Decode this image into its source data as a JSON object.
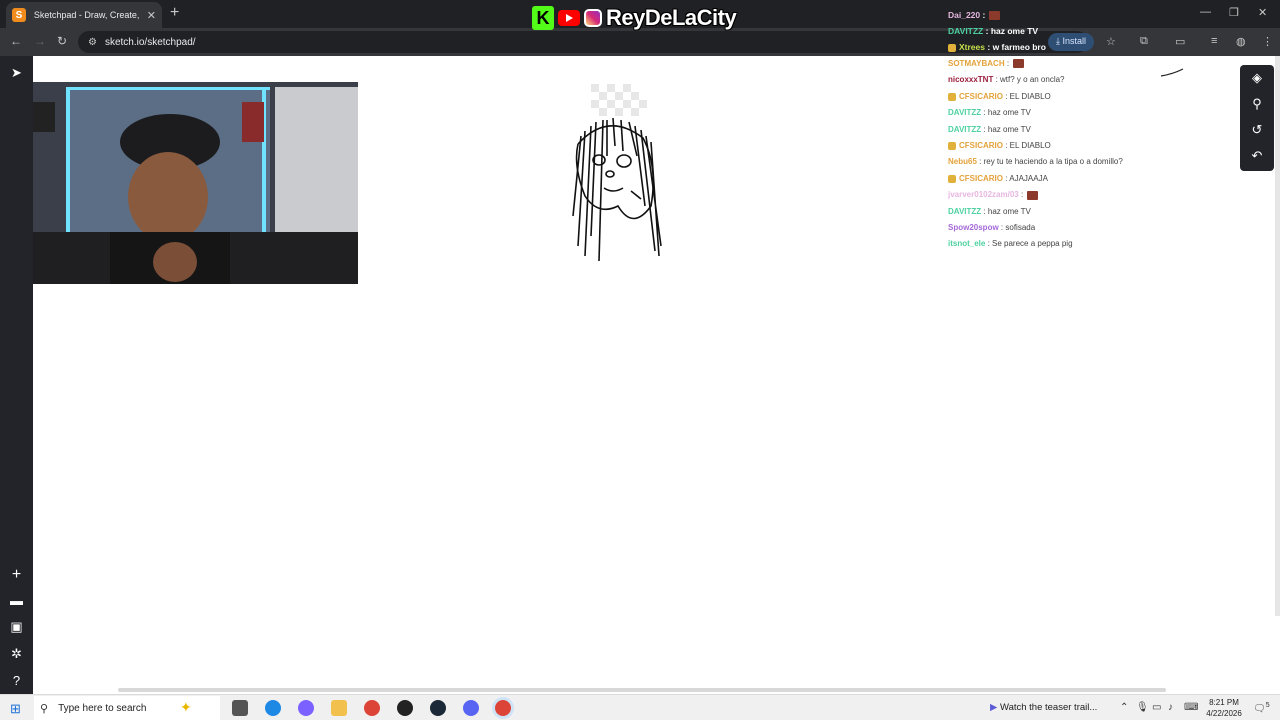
{
  "browser": {
    "tab_title": "Sketchpad - Draw, Create, Share!",
    "tab_favicon": "S",
    "new_tab": "+",
    "url": "sketch.io/sketchpad/",
    "install_label": "Install",
    "window_controls": [
      "—",
      "❐",
      "✕"
    ]
  },
  "overlay": {
    "brand": "ReyDeLaCity",
    "kick_letter": "K"
  },
  "chat": [
    {
      "user": "Dai_220",
      "text": ":",
      "color": "#e7b6e0",
      "top": true,
      "emote": true
    },
    {
      "user": "DAVITZZ",
      "text": ": haz ome TV",
      "color": "#4ed1a0",
      "top": true
    },
    {
      "user": "Xtrees",
      "text": ": w farmeo bro",
      "color": "#c6e04a",
      "top": true,
      "badge": true
    },
    {
      "user": "SOTMAYBACH",
      "text": ":",
      "color": "#e3a23a",
      "emote": true
    },
    {
      "user": "nicoxxxTNT",
      "text": ": wtf? y o an oncla?",
      "color": "#9a1e3c"
    },
    {
      "user": "CFSICARIO",
      "text": ": EL DIABLO",
      "color": "#e3a23a",
      "badge": true
    },
    {
      "user": "DAVITZZ",
      "text": ": haz ome TV",
      "color": "#4ed1a0"
    },
    {
      "user": "DAVITZZ",
      "text": ": haz ome TV",
      "color": "#4ed1a0"
    },
    {
      "user": "CFSICARIO",
      "text": ": EL DIABLO",
      "color": "#e3a23a",
      "badge": true
    },
    {
      "user": "Nebu65",
      "text": ": rey tu te haciendo a la tipa o a domillo?",
      "color": "#e3a23a"
    },
    {
      "user": "CFSICARIO",
      "text": ": AJAJAAJA",
      "color": "#e3a23a",
      "badge": true
    },
    {
      "user": "jvarver0102zam/03",
      "text": ":",
      "color": "#e7b6e0",
      "emote": true
    },
    {
      "user": "DAVITZZ",
      "text": ": haz ome TV",
      "color": "#4ed1a0"
    },
    {
      "user": "Spow20spow",
      "text": ": sofisada",
      "color": "#a66ad9"
    },
    {
      "user": "itsnot_ele",
      "text": ": Se parece a peppa pig",
      "color": "#4ed1a0"
    }
  ],
  "taskbar": {
    "search_placeholder": "Type here to search",
    "news": "Watch the teaser trail...",
    "time": "8:21 PM",
    "date": "4/22/2026",
    "notification_count": "5"
  },
  "icons": {
    "left_toolbar": [
      "pointer-icon",
      "plus-icon",
      "folder-icon",
      "save-icon",
      "settings-icon",
      "help-icon"
    ],
    "right_toolbar": [
      "layers-icon",
      "zoom-icon",
      "history-icon",
      "undo-icon"
    ]
  }
}
